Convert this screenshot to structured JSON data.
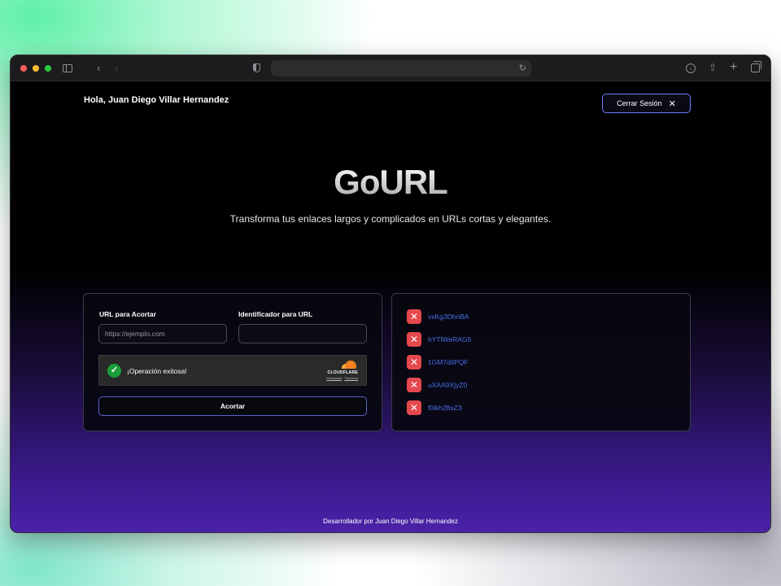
{
  "header": {
    "greeting": "Hola, Juan Diego Villar Hernandez",
    "logout_label": "Cerrar Sesión"
  },
  "hero": {
    "title": "GoURL",
    "subtitle": "Transforma tus enlaces largos y complicados en URLs cortas y elegantes."
  },
  "form": {
    "url_label": "URL para Acortar",
    "url_placeholder": "https://ejemplo.com",
    "url_value": "",
    "id_label": "Identificador para URL",
    "id_placeholder": "",
    "id_value": "",
    "captcha_status": "¡Operación exitosa!",
    "captcha_brand": "CLOUDFLARE",
    "captcha_privacy": "Privacidad",
    "captcha_terms": "Términos",
    "submit_label": "Acortar"
  },
  "links": {
    "items": [
      {
        "code": "vxKg3DhnBA"
      },
      {
        "code": "hYTlWeRAG5"
      },
      {
        "code": "1GM7diIPQF"
      },
      {
        "code": "uXAA9XjyZ0"
      },
      {
        "code": "f0ikh28xZ3"
      }
    ]
  },
  "footer": {
    "text": "Desarrollador por Juan Diego Villar Hernandez"
  },
  "colors": {
    "accent": "#6b7cff",
    "link": "#4a6fe8",
    "delete": "#e5484d",
    "success": "#1a9e3a"
  },
  "icons": {
    "logout": "close-icon",
    "delete": "close-icon",
    "captcha": "check-icon"
  }
}
